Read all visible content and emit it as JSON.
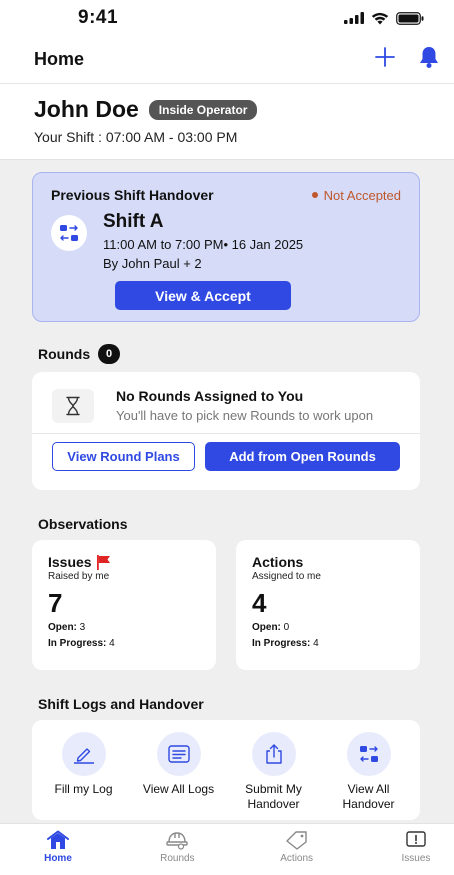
{
  "status_bar": {
    "time": "9:41"
  },
  "header": {
    "title": "Home"
  },
  "user": {
    "name": "John Doe",
    "role": "Inside Operator",
    "shift": "Your Shift : 07:00 AM - 03:00 PM"
  },
  "handover": {
    "title": "Previous Shift Handover",
    "status": "Not Accepted",
    "shift_name": "Shift A",
    "time": "11:00 AM to 7:00 PM• 16 Jan 2025",
    "by": "By John Paul + 2",
    "button": "View & Accept"
  },
  "rounds": {
    "title": "Rounds",
    "count": "0",
    "empty_title": "No Rounds Assigned to You",
    "empty_sub": "You'll have to pick new Rounds to work upon",
    "btn_plans": "View Round Plans",
    "btn_open": "Add from Open Rounds"
  },
  "observations": {
    "title": "Observations",
    "issues": {
      "title": "Issues",
      "sub": "Raised by me",
      "count": "7",
      "open_label": "Open:",
      "open_val": "3",
      "progress_label": "In Progress:",
      "progress_val": "4"
    },
    "actions": {
      "title": "Actions",
      "sub": "Assigned to me",
      "count": "4",
      "open_label": "Open:",
      "open_val": "0",
      "progress_label": "In Progress:",
      "progress_val": "4"
    }
  },
  "logs": {
    "title": "Shift Logs and Handover",
    "items": [
      {
        "label": "Fill my Log",
        "icon": "pencil-icon"
      },
      {
        "label": "View All Logs",
        "icon": "list-icon"
      },
      {
        "label": "Submit My Handover",
        "icon": "share-icon"
      },
      {
        "label": "View All Handover",
        "icon": "swap-icon"
      }
    ]
  },
  "nav": {
    "items": [
      {
        "label": "Home",
        "icon": "home-icon",
        "active": true
      },
      {
        "label": "Rounds",
        "icon": "hardhat-icon"
      },
      {
        "label": "Actions",
        "icon": "tag-icon"
      },
      {
        "label": "Issues",
        "icon": "alert-icon"
      }
    ]
  },
  "colors": {
    "accent": "#2f49e2",
    "handover_bg": "#d6dcf8",
    "warning": "#c0572a",
    "flag": "#e02424"
  }
}
